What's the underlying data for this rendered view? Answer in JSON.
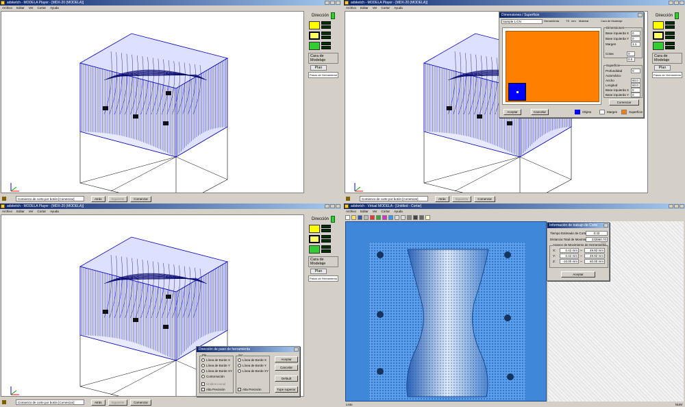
{
  "common": {
    "title": "adsketch - MODELA Player - [MDX-20 (MODELA)]",
    "menu": [
      "Archivo",
      "Editar",
      "Ver",
      "Cortar",
      "Ayuda"
    ],
    "side": {
      "direction": "Dirección",
      "surface_label": "Cara de Modelaje",
      "plan": "Plan",
      "pasos": "Pasos de Herramienta"
    },
    "status": {
      "field": "Comienzo de corte por botón [Comenzar]",
      "atras": "Atrás",
      "siguiente": "Siguiente",
      "comenzar": "Comenzar"
    },
    "colors": {
      "mesh": "#0000cc",
      "cube_yellow": "#ffff00",
      "cube_green": "#33cc33",
      "title_blue": "#0a246a"
    }
  },
  "dialog_surface": {
    "title": "Dimensiones / Superficie",
    "tabs": [
      "Sample 1.CN",
      "Herramienta",
      "TS",
      "Material",
      "Cara de Modelaje"
    ],
    "tab_unit": "mm",
    "group_dims": "Dimensiones",
    "fields": [
      {
        "label": "Base izquierda X",
        "value": "0"
      },
      {
        "label": "Base izquierda Y",
        "value": "0"
      },
      {
        "label": "Margen",
        "value": "1.1"
      }
    ],
    "group_sup": "Superficie",
    "cotas": [
      {
        "label": "Cotas",
        "value": "0"
      },
      {
        "label": "",
        "value": "0.0"
      }
    ],
    "sup_fields": [
      {
        "label": "Profundidad",
        "value": "0"
      },
      {
        "label": "Automático",
        "value": ""
      },
      {
        "label": "Ancho",
        "value": "60.0"
      },
      {
        "label": "Longitud",
        "value": "60.0"
      },
      {
        "label": "Base izquierda X",
        "value": "0"
      },
      {
        "label": "Base izquierda Y",
        "value": "0"
      }
    ],
    "comenzar": "Comenzar",
    "aceptar": "Aceptar",
    "cancelar": "Cancelar",
    "legend": [
      "Objeto",
      "Margen",
      "Superficie"
    ]
  },
  "dialog_direction": {
    "title": "Dirección de paso de herramienta",
    "col1": "Pla",
    "col2": "Scr",
    "left_opts": [
      "Línea de Borde X",
      "Línea de Borde Y",
      "Línea de Borde XY",
      "Contornación"
    ],
    "right_opts": [
      "Línea de Borde X",
      "Línea de Borde Y",
      "Línea de Borde XY"
    ],
    "disabled_opt": "Unidireccional",
    "alta_left": "Alta Precisión",
    "alta_right": "Alta Precisión",
    "aceptar": "Aceptar",
    "cancelar": "Cancelar",
    "default": "Default",
    "superior": "Tope superior"
  },
  "window4": {
    "title": "adsketch - Virtual MODELA - [Untitled - Cortar]",
    "dialog": {
      "title": "Información de trabajo de Corte",
      "time_label": "Tiempo Estimado de Corte",
      "time_value": "0:42",
      "dist_label": "Distancia Total de Movimiento",
      "dist_value": "233960.70 mm",
      "range_label": "Avance de Movimiento de Herramienta",
      "rows": [
        {
          "axis": "X:",
          "from": "0.42 mm",
          "to": "49.92 mm"
        },
        {
          "axis": "Y:",
          "from": "0.42 mm",
          "to": "49.92 mm"
        },
        {
          "axis": "Z:",
          "from": "-10.00 mm",
          "to": "60.00 mm"
        }
      ],
      "aceptar": "Aceptar"
    },
    "status_left": "Listo",
    "status_right": "NUM"
  }
}
